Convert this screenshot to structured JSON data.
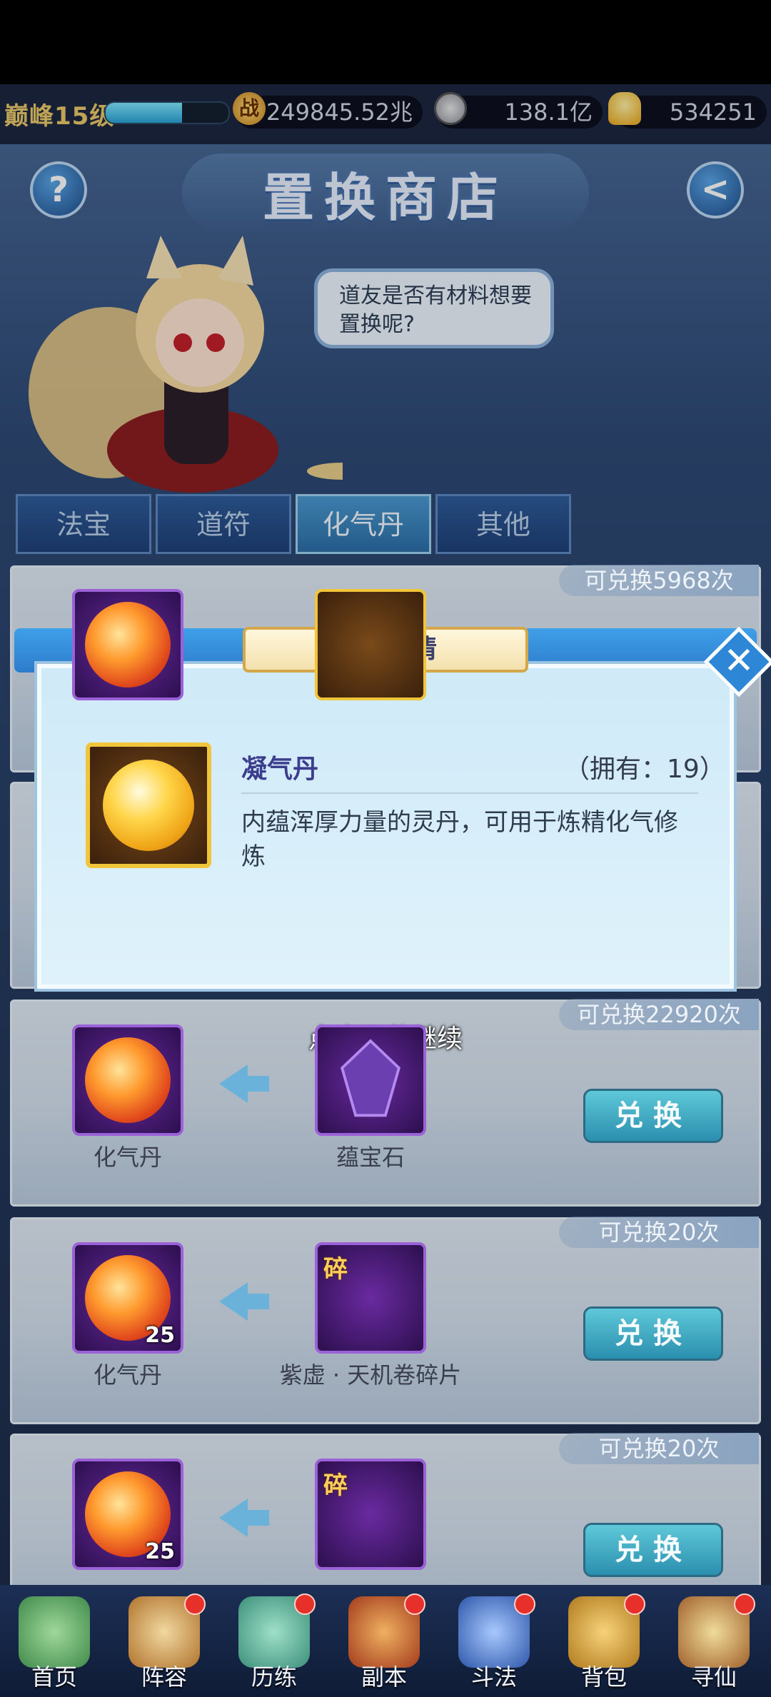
{
  "header": {
    "level": "巅峰15级",
    "xp_progress": 0.62,
    "battle_power": "249845.52兆",
    "coins": "138.1亿",
    "gold": "534251",
    "battle_icon_text": "战"
  },
  "page": {
    "title": "置换商店",
    "help_symbol": "?",
    "back_symbol": "<"
  },
  "npc": {
    "speech": "道友是否有材料想要置换呢?"
  },
  "tabs": [
    {
      "label": "法宝",
      "active": false
    },
    {
      "label": "道符",
      "active": false
    },
    {
      "label": "化气丹",
      "active": true
    },
    {
      "label": "其他",
      "active": false
    }
  ],
  "exchange_list": [
    {
      "count_text": "可兑换5968次"
    },
    {
      "count_text": ""
    },
    {
      "count_text": "可兑换22920次",
      "reward_name": "化气丹",
      "reward_qty": "",
      "cost_name": "蕴宝石",
      "cost_fragment": "",
      "button": "兑换"
    },
    {
      "count_text": "可兑换20次",
      "reward_name": "化气丹",
      "reward_qty": "25",
      "cost_name": "紫虚 · 天机卷碎片",
      "cost_fragment": "碎",
      "button": "兑换"
    },
    {
      "count_text": "可兑换20次",
      "reward_name": "",
      "reward_qty": "25",
      "cost_name": "",
      "cost_fragment": "碎",
      "button": "兑换"
    }
  ],
  "popup": {
    "title": "道具详情",
    "item_name": "凝气丹",
    "owned": "（拥有：19）",
    "description": "内蕴浑厚力量的灵丹，可用于炼精化气修炼",
    "close_symbol": "✕",
    "tap_hint": "点击屏幕继续"
  },
  "bottom_nav": [
    {
      "label": "首页",
      "icon": "home-icon",
      "dot": false
    },
    {
      "label": "阵容",
      "icon": "lineup-icon",
      "dot": true
    },
    {
      "label": "历练",
      "icon": "training-icon",
      "dot": true
    },
    {
      "label": "副本",
      "icon": "dungeon-icon",
      "dot": true
    },
    {
      "label": "斗法",
      "icon": "duel-icon",
      "dot": true
    },
    {
      "label": "背包",
      "icon": "bag-icon",
      "dot": true
    },
    {
      "label": "寻仙",
      "icon": "seek-icon",
      "dot": true
    }
  ],
  "colors": {
    "accent_blue": "#2e86d6",
    "gold_border": "#f1c53a",
    "exchange_button": "#2a8fae"
  }
}
